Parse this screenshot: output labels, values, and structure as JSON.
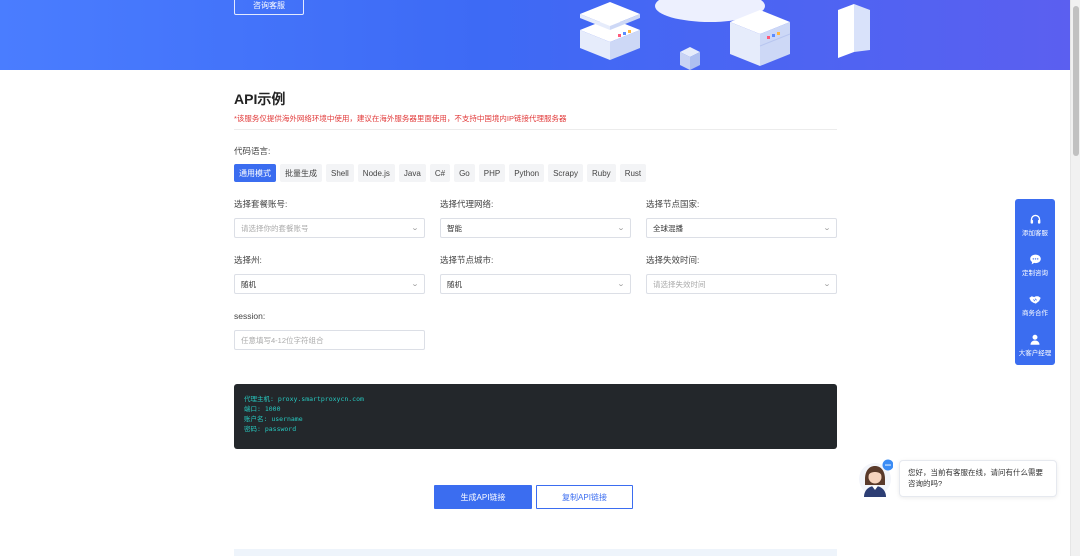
{
  "banner": {
    "consult_label": "咨询客服"
  },
  "api": {
    "title": "API示例",
    "notice": "*该服务仅提供海外网络环境中使用，建议在海外服务器里面使用，不支持中国境内IP链接代理服务器",
    "language_label": "代码语言:",
    "languages": [
      "通用模式",
      "批量生成",
      "Shell",
      "Node.js",
      "Java",
      "C#",
      "Go",
      "PHP",
      "Python",
      "Scrapy",
      "Ruby",
      "Rust"
    ]
  },
  "form": {
    "package_account": {
      "label": "选择套餐账号:",
      "placeholder": "请选择你的套餐账号"
    },
    "proxy_network": {
      "label": "选择代理网络:",
      "value": "智能"
    },
    "node_country": {
      "label": "选择节点国家:",
      "value": "全球混播"
    },
    "state": {
      "label": "选择州:",
      "value": "随机"
    },
    "node_city": {
      "label": "选择节点城市:",
      "value": "随机"
    },
    "expire_time": {
      "label": "选择失效时间:",
      "placeholder": "请选择失效时间"
    },
    "session": {
      "label": "session:",
      "placeholder": "任意填写4-12位字符组合"
    }
  },
  "code": {
    "lines": [
      "代理主机: proxy.smartproxycn.com",
      "端口: 1000",
      "账户名: username",
      "密码: password"
    ]
  },
  "actions": {
    "generate_label": "生成API链接",
    "copy_label": "复制API链接"
  },
  "float_bar": {
    "items": [
      {
        "label": "添加客服",
        "icon": "headset-icon"
      },
      {
        "label": "定制咨询",
        "icon": "chat-icon"
      },
      {
        "label": "商务合作",
        "icon": "handshake-icon"
      },
      {
        "label": "大客户经理",
        "icon": "user-icon"
      }
    ]
  },
  "chat": {
    "message": "您好，当前有客服在线，请问有什么需要咨询的吗?"
  },
  "colors": {
    "primary": "#3b6df0",
    "notice": "#e23b3b",
    "code_bg": "#23272b",
    "code_text": "#27c9c0"
  }
}
